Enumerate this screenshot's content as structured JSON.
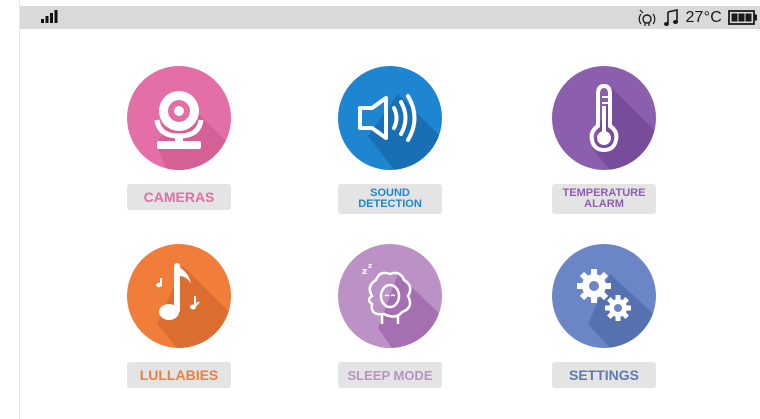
{
  "status": {
    "temperature": "27°C",
    "icons": [
      "signal-strength-icon",
      "vox-icon",
      "music-note-icon",
      "battery-icon"
    ]
  },
  "tiles": [
    {
      "id": "cameras",
      "label_lines": [
        "CAMERAS"
      ],
      "color": "#e46fa6",
      "label_color": "#e46fa6",
      "icon": "camera-icon"
    },
    {
      "id": "sound-detection",
      "label_lines": [
        "SOUND",
        "DETECTION"
      ],
      "color": "#1e86d0",
      "label_color": "#1e86d0",
      "icon": "speaker-icon"
    },
    {
      "id": "temperature-alarm",
      "label_lines": [
        "TEMPERATURE",
        "ALARM"
      ],
      "color": "#8c5fae",
      "label_color": "#8c5fae",
      "icon": "thermometer-icon"
    },
    {
      "id": "lullabies",
      "label_lines": [
        "LULLABIES"
      ],
      "color": "#f07e3a",
      "label_color": "#f07e3a",
      "icon": "music-notes-icon"
    },
    {
      "id": "sleep-mode",
      "label_lines": [
        "SLEEP MODE"
      ],
      "color": "#bc92c6",
      "label_color": "#bc92c6",
      "icon": "sheep-icon"
    },
    {
      "id": "settings",
      "label_lines": [
        "SETTINGS"
      ],
      "color": "#6a86c6",
      "label_color": "#5d79b8",
      "icon": "gears-icon"
    }
  ]
}
